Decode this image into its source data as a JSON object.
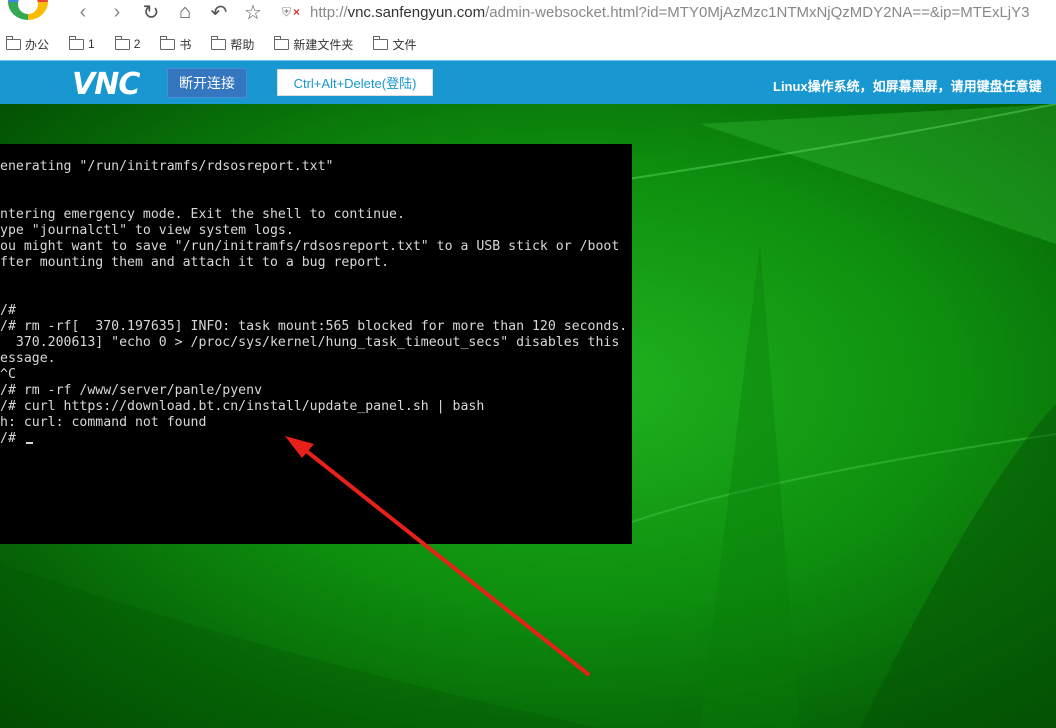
{
  "browser": {
    "nav_icons": [
      "back-icon",
      "forward-icon",
      "reload-icon",
      "home-icon",
      "undo-icon",
      "star-icon"
    ],
    "address": {
      "scheme": "http://",
      "host": "vnc.sanfengyun.com",
      "rest": "/admin-websocket.html?id=MTY0MjAzMzc1NTMxNjQzMDY2NA==&ip=MTExLjY3"
    },
    "bookmarks": [
      "办公",
      "1",
      "2",
      "书",
      "帮助",
      "新建文件夹",
      "文件"
    ]
  },
  "vnc": {
    "logo": "VNC",
    "disconnect_label": "断开连接",
    "cad_label": "Ctrl+Alt+Delete(登陆)",
    "notice": "Linux操作系统，如屏幕黑屏，请用键盘任意键"
  },
  "terminal": {
    "lines": [
      "enerating \"/run/initramfs/rdsosreport.txt\"",
      "",
      "",
      "ntering emergency mode. Exit the shell to continue.",
      "ype \"journalctl\" to view system logs.",
      "ou might want to save \"/run/initramfs/rdsosreport.txt\" to a USB stick or /boot",
      "fter mounting them and attach it to a bug report.",
      "",
      "",
      "",
      "/#",
      "/# rm -rf[  370.197635] INFO: task mount:565 blocked for more than 120 seconds.",
      "  370.200613] \"echo 0 > /proc/sys/kernel/hung_task_timeout_secs\" disables this",
      "essage.",
      "^C",
      "/# rm -rf /www/server/panle/pyenv",
      "/# curl https://download.bt.cn/install/update_panel.sh | bash",
      "h: curl: command not found",
      "/# "
    ]
  },
  "colors": {
    "vnc_header": "#1897d0",
    "disconnect_button": "#3476c0",
    "desktop_green": "#0e8f0e",
    "annotation_arrow": "#e8201a"
  }
}
